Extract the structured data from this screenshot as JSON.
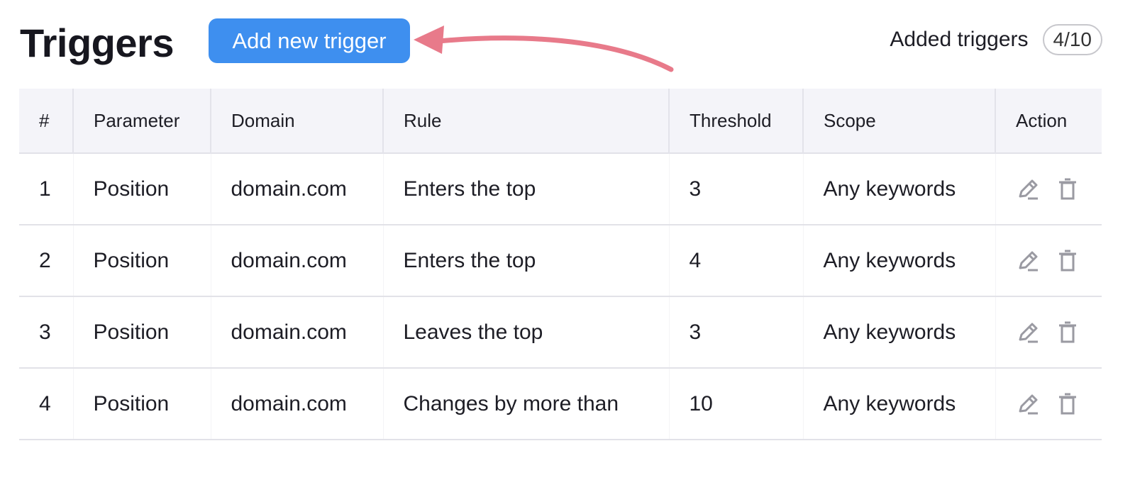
{
  "header": {
    "title": "Triggers",
    "add_button_label": "Add new trigger",
    "counter_label": "Added triggers",
    "counter_value": "4/10"
  },
  "colors": {
    "primary": "#3e8fef",
    "annotation_arrow": "#e87a8a",
    "icon_gray": "#9a9aa2"
  },
  "table": {
    "columns": [
      "#",
      "Parameter",
      "Domain",
      "Rule",
      "Threshold",
      "Scope",
      "Action"
    ],
    "rows": [
      {
        "num": "1",
        "parameter": "Position",
        "domain": "domain.com",
        "rule": "Enters the top",
        "threshold": "3",
        "scope": "Any keywords"
      },
      {
        "num": "2",
        "parameter": "Position",
        "domain": "domain.com",
        "rule": "Enters the top",
        "threshold": "4",
        "scope": "Any keywords"
      },
      {
        "num": "3",
        "parameter": "Position",
        "domain": "domain.com",
        "rule": "Leaves the top",
        "threshold": "3",
        "scope": "Any keywords"
      },
      {
        "num": "4",
        "parameter": "Position",
        "domain": "domain.com",
        "rule": "Changes by more than",
        "threshold": "10",
        "scope": "Any keywords"
      }
    ],
    "action_icons": [
      "pencil-icon",
      "trash-icon"
    ]
  }
}
